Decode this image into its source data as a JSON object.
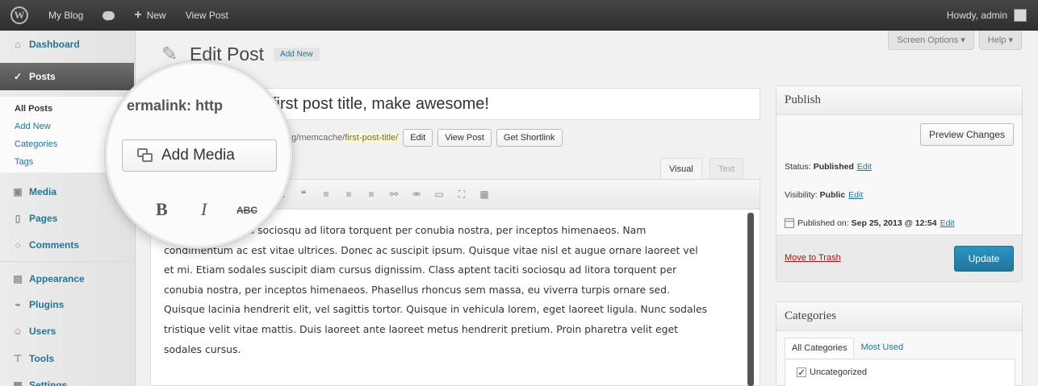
{
  "admin_bar": {
    "site_name": "My Blog",
    "new_label": "New",
    "view_post": "View Post",
    "greeting": "Howdy, admin"
  },
  "sidebar": {
    "items": [
      {
        "label": "Dashboard",
        "icon": "dashboard-icon"
      },
      {
        "label": "Posts",
        "icon": "pushpin-icon"
      },
      {
        "label": "Media",
        "icon": "media-icon"
      },
      {
        "label": "Pages",
        "icon": "pages-icon"
      },
      {
        "label": "Comments",
        "icon": "comments-icon"
      },
      {
        "label": "Appearance",
        "icon": "appearance-icon"
      },
      {
        "label": "Plugins",
        "icon": "plugins-icon"
      },
      {
        "label": "Users",
        "icon": "users-icon"
      },
      {
        "label": "Tools",
        "icon": "tools-icon"
      },
      {
        "label": "Settings",
        "icon": "settings-icon"
      }
    ],
    "posts_submenu": [
      "All Posts",
      "Add New",
      "Categories",
      "Tags"
    ]
  },
  "screen_options": {
    "screen_options_label": "Screen Options ▾",
    "help_label": "Help ▾"
  },
  "heading": {
    "title": "Edit Post",
    "add_new": "Add New"
  },
  "editor": {
    "title_value": "first post title, make awesome!",
    "permalink_base": "...pt.org/memcache/",
    "permalink_slug": "first-post-title/",
    "edit_btn": "Edit",
    "view_post_btn": "View Post",
    "shortlink_btn": "Get Shortlink",
    "tab_visual": "Visual",
    "tab_text": "Text",
    "content": "Class aptent taciti sociosqu ad litora torquent per conubia nostra, per inceptos himenaeos. Nam condimentum ac est vitae ultrices. Donec ac suscipit ipsum. Quisque vitae nisl et augue ornare laoreet vel et mi. Etiam sodales suscipit diam cursus dignissim. Class aptent taciti sociosqu ad litora torquent per conubia nostra, per inceptos himenaeos. Phasellus rhoncus sem massa, eu viverra turpis ornare sed. Quisque lacinia hendrerit elit, vel sagittis tortor. Quisque in vehicula lorem, eget laoreet ligula. Nunc sodales tristique velit vitae mattis. Duis laoreet ante laoreet metus hendrerit pretium. Proin pharetra velit eget sodales cursus."
  },
  "magnifier": {
    "permalink_label": "ermalink: http",
    "add_media": "Add Media",
    "bold": "B",
    "italic": "I",
    "strike": "ABC"
  },
  "publish": {
    "title": "Publish",
    "preview_btn": "Preview Changes",
    "status_label": "Status:",
    "status_value": "Published",
    "visibility_label": "Visibility:",
    "visibility_value": "Public",
    "published_label": "Published on:",
    "published_value": "Sep 25, 2013 @ 12:54",
    "edit_link": "Edit",
    "trash": "Move to Trash",
    "update_btn": "Update"
  },
  "categories": {
    "title": "Categories",
    "tab_all": "All Categories",
    "tab_most_used": "Most Used",
    "item": "Uncategorized"
  }
}
